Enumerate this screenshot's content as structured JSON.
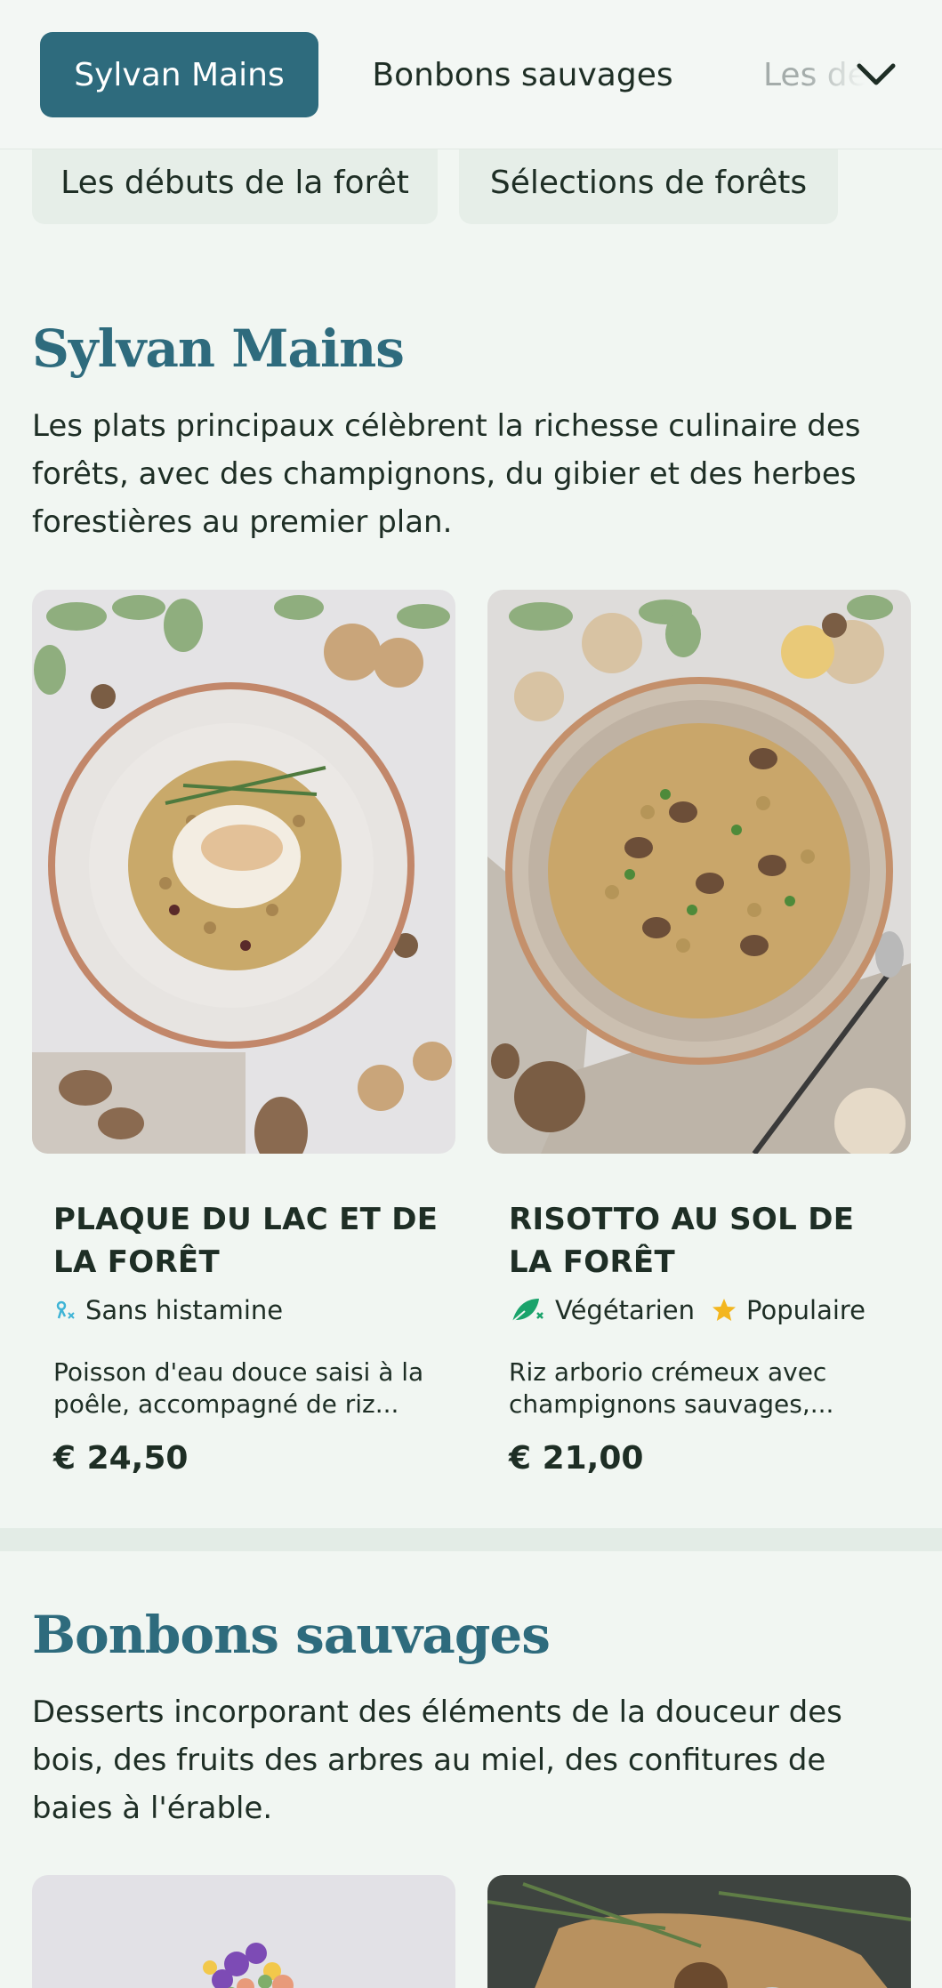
{
  "nav": {
    "tabs": [
      {
        "label": "Sylvan Mains",
        "active": true
      },
      {
        "label": "Bonbons sauvages",
        "active": false
      },
      {
        "label": "Les débuts de la forêt",
        "active": false
      }
    ],
    "more_icon": "chevron-down-icon",
    "pills": [
      "Les débuts de la forêt",
      "Sélections de forêts"
    ]
  },
  "colors": {
    "accent": "#2e6b7d",
    "background": "#f1f6f2",
    "text": "#1e2e25",
    "vegetarian": "#1aa36b",
    "popular": "#f3b61f",
    "histamine": "#3fb4d6"
  },
  "sections": [
    {
      "title": "Sylvan Mains",
      "description": "Les plats principaux célèbrent la richesse culinaire des forêts, avec des champignons, du gibier et des herbes forestières au premier plan.",
      "items": [
        {
          "name": "PLAQUE DU LAC ET DE LA FORÊT",
          "tags": [
            {
              "icon": "histamine-free-icon",
              "label": "Sans histamine"
            }
          ],
          "description": "Poisson d'eau douce saisi à la poêle, accompagné de riz...",
          "price": "€ 24,50"
        },
        {
          "name": "RISOTTO AU SOL DE LA FORÊT",
          "tags": [
            {
              "icon": "vegetarian-icon",
              "label": "Végétarien"
            },
            {
              "icon": "star-icon",
              "label": "Populaire"
            }
          ],
          "description": "Riz arborio crémeux avec champignons sauvages,...",
          "price": "€ 21,00"
        }
      ]
    },
    {
      "title": "Bonbons sauvages",
      "description": "Desserts incorporant des éléments de la douceur des bois, des fruits des arbres au miel, des confitures de baies à l'érable."
    }
  ]
}
